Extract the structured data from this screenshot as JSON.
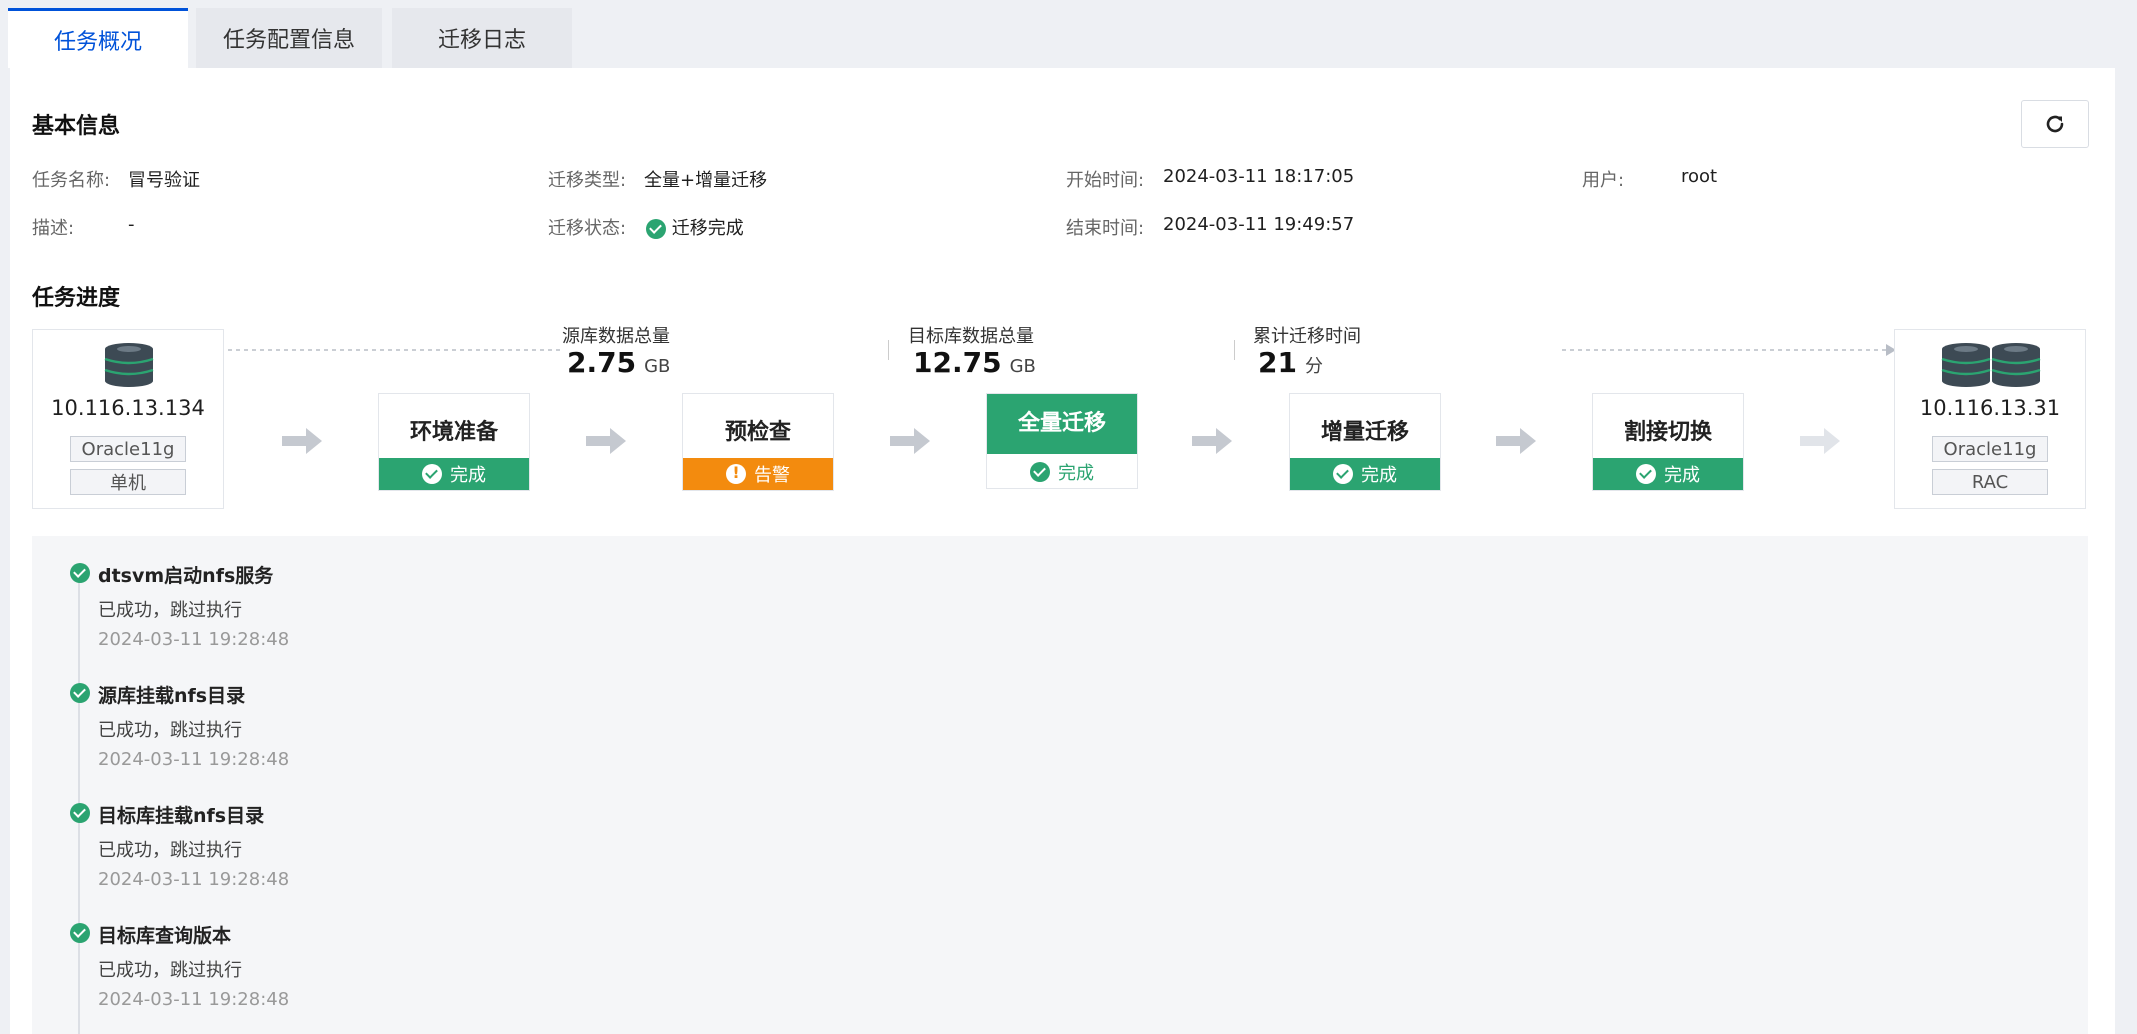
{
  "tabs": [
    "任务概况",
    "任务配置信息",
    "迁移日志"
  ],
  "basic": {
    "heading": "基本信息",
    "task_name_label": "任务名称:",
    "task_name": "冒号验证",
    "desc_label": "描述:",
    "desc": "-",
    "type_label": "迁移类型:",
    "type": "全量+增量迁移",
    "status_label": "迁移状态:",
    "status": "迁移完成",
    "start_label": "开始时间:",
    "start": "2024-03-11 18:17:05",
    "end_label": "结束时间:",
    "end": "2024-03-11 19:49:57",
    "user_label": "用户:",
    "user": "root"
  },
  "progress": {
    "heading": "任务进度",
    "source": {
      "ip": "10.116.13.134",
      "db": "Oracle11g",
      "mode": "单机"
    },
    "target": {
      "ip": "10.116.13.31",
      "db": "Oracle11g",
      "mode": "RAC"
    },
    "metrics": [
      {
        "label": "源库数据总量",
        "value": "2.75",
        "unit": "GB"
      },
      {
        "label": "目标库数据总量",
        "value": "12.75",
        "unit": "GB"
      },
      {
        "label": "累计迁移时间",
        "value": "21",
        "unit": "分"
      }
    ],
    "steps": [
      {
        "title": "环境准备",
        "status": "完成"
      },
      {
        "title": "预检查",
        "status": "告警"
      },
      {
        "title": "全量迁移",
        "status": "完成"
      },
      {
        "title": "增量迁移",
        "status": "完成"
      },
      {
        "title": "割接切换",
        "status": "完成"
      }
    ]
  },
  "logs": [
    {
      "title": "dtsvm启动nfs服务",
      "status": "已成功，跳过执行",
      "time": "2024-03-11 19:28:48"
    },
    {
      "title": "源库挂载nfs目录",
      "status": "已成功，跳过执行",
      "time": "2024-03-11 19:28:48"
    },
    {
      "title": "目标库挂载nfs目录",
      "status": "已成功，跳过执行",
      "time": "2024-03-11 19:28:48"
    },
    {
      "title": "目标库查询版本",
      "status": "已成功，跳过执行",
      "time": "2024-03-11 19:28:48"
    }
  ],
  "colors": {
    "accent": "#0052d9",
    "success": "#2ba471",
    "warning": "#f38b0e"
  }
}
